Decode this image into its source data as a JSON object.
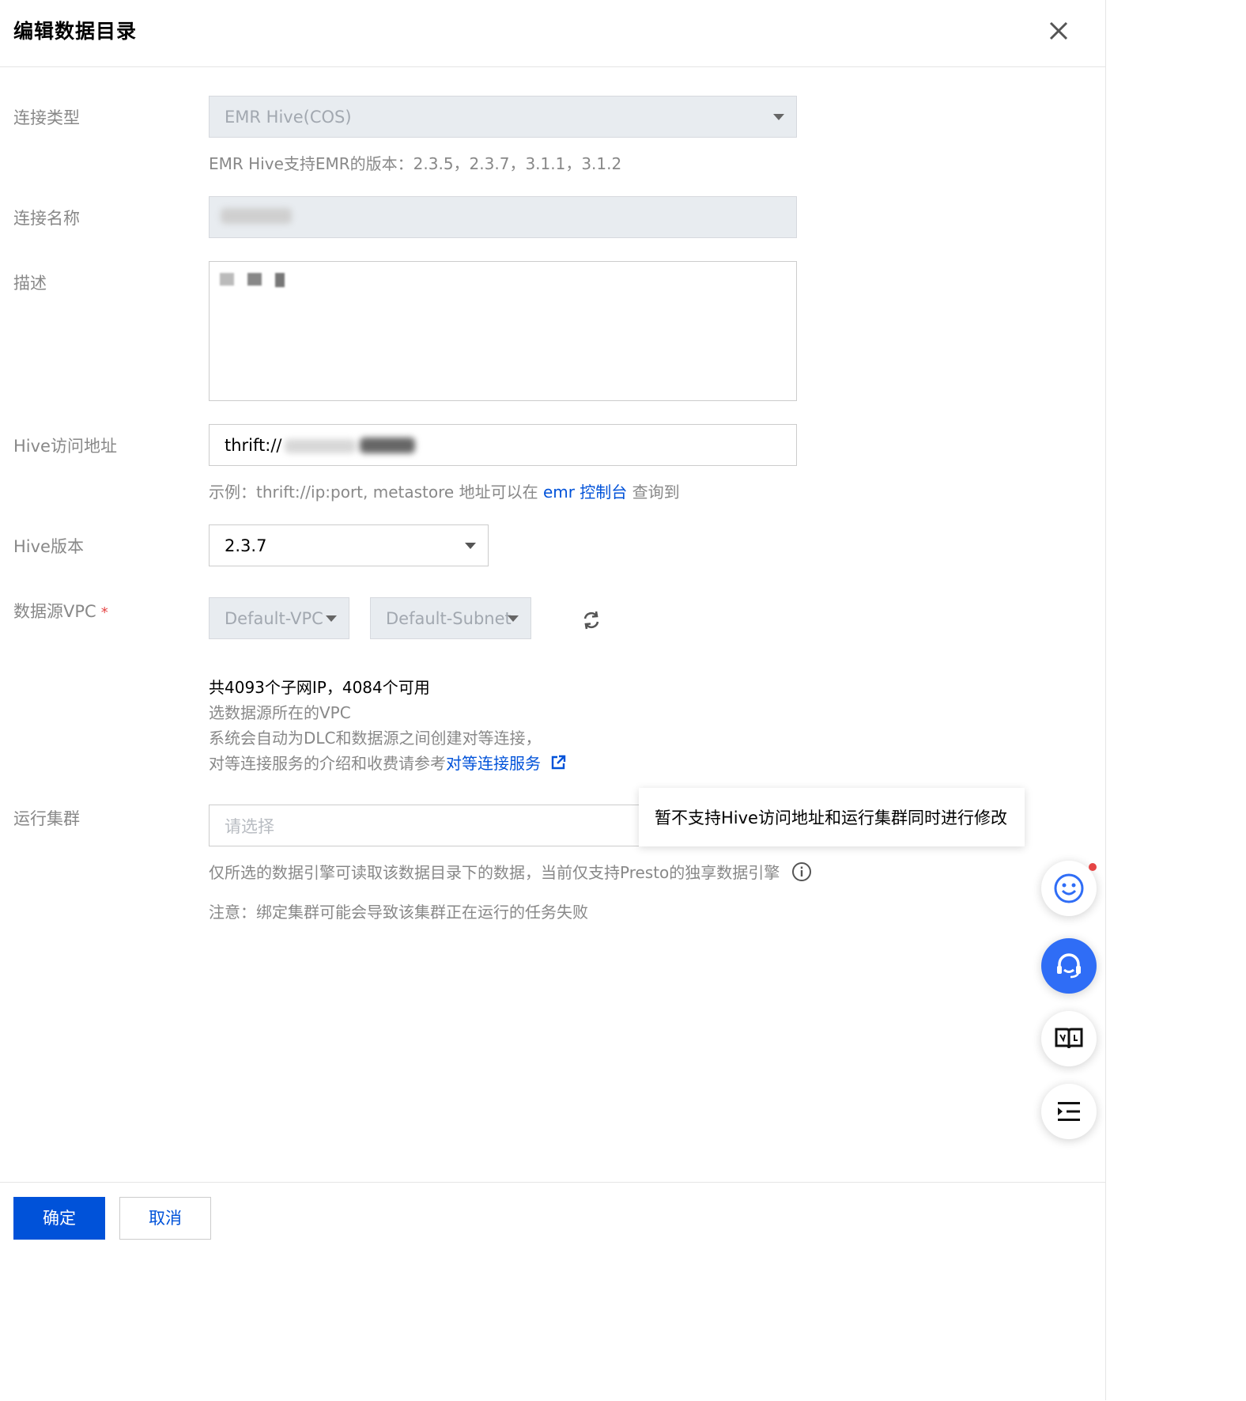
{
  "dialog": {
    "title": "编辑数据目录"
  },
  "labels": {
    "connection_type": "连接类型",
    "connection_name": "连接名称",
    "description": "描述",
    "hive_address": "Hive访问地址",
    "hive_version": "Hive版本",
    "vpc": "数据源VPC",
    "vpc_required_mark": "*",
    "cluster": "运行集群"
  },
  "connection_type": {
    "value": "EMR Hive(COS)",
    "hint": "EMR Hive支持EMR的版本：2.3.5，2.3.7，3.1.1，3.1.2"
  },
  "hive_address": {
    "value_prefix": "thrift://",
    "hint_prefix": "示例：thrift://ip:port, metastore 地址可以在",
    "hint_link": "emr 控制台",
    "hint_suffix": "查询到"
  },
  "hive_version": {
    "value": "2.3.7"
  },
  "vpc": {
    "vpc_value": "Default-VPC",
    "subnet_value": "Default-Subnet",
    "ip_info": "共4093个子网IP，4084个可用",
    "line1": "选数据源所在的VPC",
    "line2": "系统会自动为DLC和数据源之间创建对等连接，",
    "line3_prefix": "对等连接服务的介绍和收费请参考",
    "line3_link": "对等连接服务"
  },
  "cluster": {
    "placeholder": "请选择",
    "hint": "仅所选的数据引擎可读取该数据目录下的数据，当前仅支持Presto的独享数据引擎",
    "note": "注意：绑定集群可能会导致该集群正在运行的任务失败"
  },
  "tooltip": {
    "text": "暂不支持Hive访问地址和运行集群同时进行修改"
  },
  "footer": {
    "confirm": "确定",
    "cancel": "取消"
  },
  "icons": {
    "close": "close-icon",
    "refresh": "refresh-icon",
    "external": "external-link-icon",
    "info": "info-icon",
    "smiley": "smiley-icon",
    "headset": "headset-icon",
    "book": "book-icon",
    "menu": "menu-indent-icon"
  },
  "colors": {
    "primary": "#0052d9",
    "danger": "#e54545",
    "float_primary": "#2f6df6"
  }
}
